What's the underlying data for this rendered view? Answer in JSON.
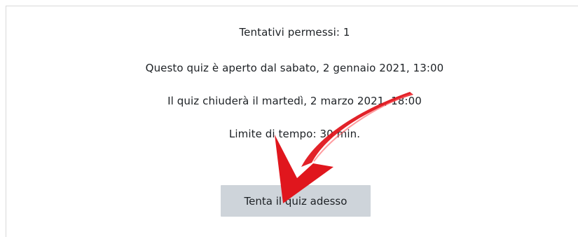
{
  "quiz": {
    "attempts_allowed": "Tentativi permessi: 1",
    "opens": "Questo quiz è aperto dal sabato, 2 gennaio 2021, 13:00",
    "closes": "Il quiz chiuderà il martedì, 2 marzo 2021, 18:00",
    "time_limit": "Limite di tempo: 30 min.",
    "attempt_button_label": "Tenta il quiz adesso"
  },
  "colors": {
    "button_bg": "#ced4da",
    "text": "#1d2125",
    "annotation_arrow": "#e0161d"
  },
  "icons": {
    "annotation": "arrow-icon"
  }
}
